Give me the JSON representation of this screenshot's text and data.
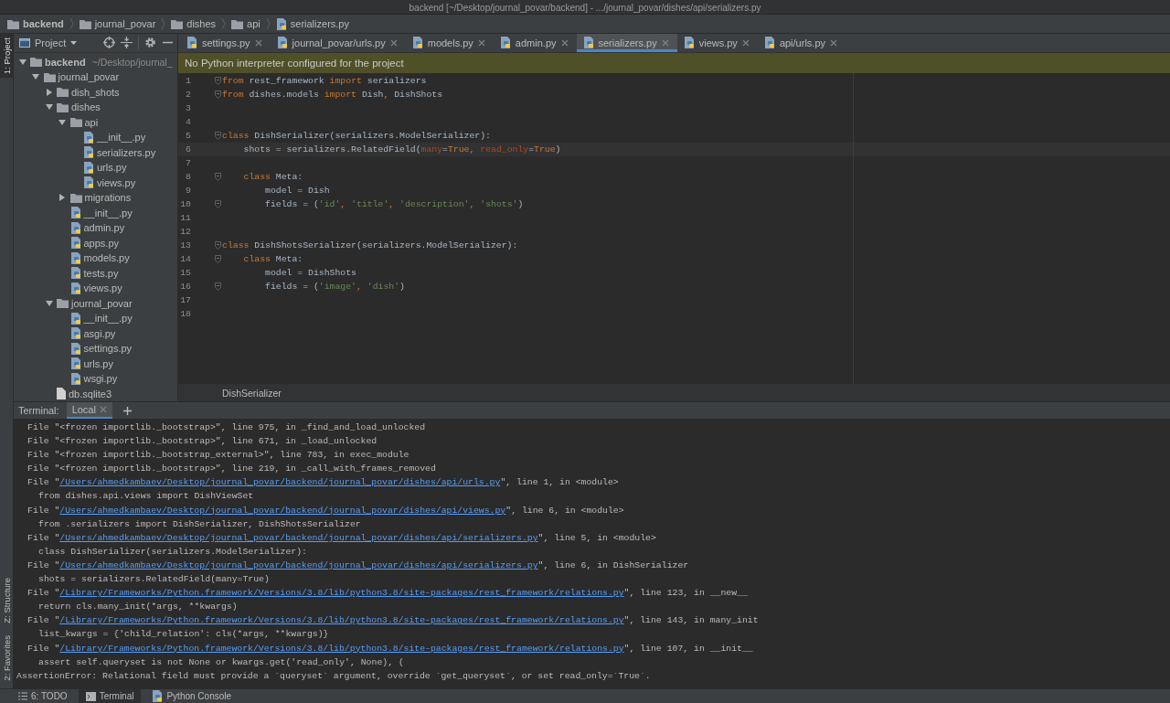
{
  "window": {
    "title": "backend [~/Desktop/journal_povar/backend] - .../journal_povar/dishes/api/serializers.py"
  },
  "breadcrumbs": [
    {
      "label": "backend",
      "kind": "folder"
    },
    {
      "label": "journal_povar",
      "kind": "folder"
    },
    {
      "label": "dishes",
      "kind": "folder"
    },
    {
      "label": "api",
      "kind": "folder"
    },
    {
      "label": "serializers.py",
      "kind": "python"
    }
  ],
  "tool_windows_top": [
    {
      "label": "1: Project",
      "selected": true
    }
  ],
  "tool_windows_bottom": [
    {
      "label": "Z: Structure",
      "selected": false
    },
    {
      "label": "2: Favorites",
      "selected": false
    }
  ],
  "project_panel": {
    "title": "Project",
    "tree": [
      {
        "label": "backend",
        "kind": "folder",
        "expanded": true,
        "hint": "~/Desktop/journal_",
        "children": [
          {
            "label": "journal_povar",
            "kind": "folder",
            "expanded": true,
            "children": [
              {
                "label": "dish_shots",
                "kind": "folder",
                "expanded": false
              },
              {
                "label": "dishes",
                "kind": "folder",
                "expanded": true,
                "children": [
                  {
                    "label": "api",
                    "kind": "folder",
                    "expanded": true,
                    "children": [
                      {
                        "label": "__init__.py",
                        "kind": "python"
                      },
                      {
                        "label": "serializers.py",
                        "kind": "python"
                      },
                      {
                        "label": "urls.py",
                        "kind": "python"
                      },
                      {
                        "label": "views.py",
                        "kind": "python"
                      }
                    ]
                  },
                  {
                    "label": "migrations",
                    "kind": "folder",
                    "expanded": false
                  },
                  {
                    "label": "__init__.py",
                    "kind": "python"
                  },
                  {
                    "label": "admin.py",
                    "kind": "python"
                  },
                  {
                    "label": "apps.py",
                    "kind": "python"
                  },
                  {
                    "label": "models.py",
                    "kind": "python"
                  },
                  {
                    "label": "tests.py",
                    "kind": "python"
                  },
                  {
                    "label": "views.py",
                    "kind": "python"
                  }
                ]
              },
              {
                "label": "journal_povar",
                "kind": "folder",
                "expanded": true,
                "children": [
                  {
                    "label": "__init__.py",
                    "kind": "python"
                  },
                  {
                    "label": "asgi.py",
                    "kind": "python"
                  },
                  {
                    "label": "settings.py",
                    "kind": "python"
                  },
                  {
                    "label": "urls.py",
                    "kind": "python"
                  },
                  {
                    "label": "wsgi.py",
                    "kind": "python"
                  }
                ]
              },
              {
                "label": "db.sqlite3",
                "kind": "file"
              }
            ]
          }
        ]
      }
    ]
  },
  "editor": {
    "tabs": [
      {
        "label": "settings.py",
        "selected": false
      },
      {
        "label": "journal_povar/urls.py",
        "selected": false
      },
      {
        "label": "models.py",
        "selected": false
      },
      {
        "label": "admin.py",
        "selected": false
      },
      {
        "label": "serializers.py",
        "selected": true
      },
      {
        "label": "views.py",
        "selected": false
      },
      {
        "label": "api/urls.py",
        "selected": false
      }
    ],
    "banner": "No Python interpreter configured for the project",
    "lines": [
      {
        "number": "1",
        "fold": true,
        "current": false,
        "tokens": [
          {
            "kind": "keyword",
            "text": "from"
          },
          {
            "kind": "plain",
            "text": " rest_framework "
          },
          {
            "kind": "keyword",
            "text": "import"
          },
          {
            "kind": "plain",
            "text": " serializers"
          }
        ]
      },
      {
        "number": "2",
        "fold": true,
        "current": false,
        "tokens": [
          {
            "kind": "keyword",
            "text": "from"
          },
          {
            "kind": "plain",
            "text": " dishes.models "
          },
          {
            "kind": "keyword",
            "text": "import"
          },
          {
            "kind": "plain",
            "text": " Dish"
          },
          {
            "kind": "keyword",
            "text": ","
          },
          {
            "kind": "plain",
            "text": " DishShots"
          }
        ]
      },
      {
        "number": "3",
        "fold": false,
        "current": false
      },
      {
        "number": "4",
        "fold": false,
        "current": false
      },
      {
        "number": "5",
        "fold": true,
        "current": false,
        "tokens": [
          {
            "kind": "keyword",
            "text": "class"
          },
          {
            "kind": "plain",
            "text": " DishSerializer(serializers.ModelSerializer):"
          }
        ]
      },
      {
        "number": "6",
        "fold": false,
        "current": true,
        "tokens": [
          {
            "kind": "plain",
            "text": "    shots = serializers.RelatedField("
          },
          {
            "kind": "param",
            "text": "many"
          },
          {
            "kind": "plain",
            "text": "="
          },
          {
            "kind": "keyword",
            "text": "True"
          },
          {
            "kind": "keyword",
            "text": ", "
          },
          {
            "kind": "param",
            "text": "read_only"
          },
          {
            "kind": "plain",
            "text": "="
          },
          {
            "kind": "keyword",
            "text": "True"
          },
          {
            "kind": "plain",
            "text": ")"
          }
        ]
      },
      {
        "number": "7",
        "fold": false,
        "current": false
      },
      {
        "number": "8",
        "fold": true,
        "current": false,
        "tokens": [
          {
            "kind": "keyword",
            "text": "    class"
          },
          {
            "kind": "plain",
            "text": " Meta:"
          }
        ]
      },
      {
        "number": "9",
        "fold": false,
        "current": false,
        "tokens": [
          {
            "kind": "plain",
            "text": "        model = Dish"
          }
        ]
      },
      {
        "number": "10",
        "fold": true,
        "current": false,
        "tokens": [
          {
            "kind": "plain",
            "text": "        fields = ("
          },
          {
            "kind": "string",
            "text": "'id'"
          },
          {
            "kind": "keyword",
            "text": ", "
          },
          {
            "kind": "string",
            "text": "'title'"
          },
          {
            "kind": "keyword",
            "text": ", "
          },
          {
            "kind": "string",
            "text": "'description'"
          },
          {
            "kind": "keyword",
            "text": ", "
          },
          {
            "kind": "string",
            "text": "'shots'"
          },
          {
            "kind": "plain",
            "text": ")"
          }
        ]
      },
      {
        "number": "11",
        "fold": false,
        "current": false
      },
      {
        "number": "12",
        "fold": false,
        "current": false
      },
      {
        "number": "13",
        "fold": true,
        "current": false,
        "tokens": [
          {
            "kind": "keyword",
            "text": "class"
          },
          {
            "kind": "plain",
            "text": " DishShotsSerializer(serializers.ModelSerializer):"
          }
        ]
      },
      {
        "number": "14",
        "fold": true,
        "current": false,
        "tokens": [
          {
            "kind": "keyword",
            "text": "    class"
          },
          {
            "kind": "plain",
            "text": " Meta:"
          }
        ]
      },
      {
        "number": "15",
        "fold": false,
        "current": false,
        "tokens": [
          {
            "kind": "plain",
            "text": "        model = DishShots"
          }
        ]
      },
      {
        "number": "16",
        "fold": true,
        "current": false,
        "tokens": [
          {
            "kind": "plain",
            "text": "        fields = ("
          },
          {
            "kind": "string",
            "text": "'image'"
          },
          {
            "kind": "keyword",
            "text": ", "
          },
          {
            "kind": "string",
            "text": "'dish'"
          },
          {
            "kind": "plain",
            "text": ")"
          }
        ]
      },
      {
        "number": "17",
        "fold": false,
        "current": false
      },
      {
        "number": "18",
        "fold": false,
        "current": false
      }
    ],
    "breadcrumb": "DishSerializer"
  },
  "terminal": {
    "label": "Terminal:",
    "tabs": [
      {
        "label": "Local",
        "selected": true
      }
    ],
    "lines": [
      {
        "kind": "frame",
        "parts": [
          {
            "kind": "text",
            "text": "File \"<frozen importlib._bootstrap>\", line 975, in _find_and_load_unlocked"
          }
        ]
      },
      {
        "kind": "frame",
        "parts": [
          {
            "kind": "text",
            "text": "File \"<frozen importlib._bootstrap>\", line 671, in _load_unlocked"
          }
        ]
      },
      {
        "kind": "frame",
        "parts": [
          {
            "kind": "text",
            "text": "File \"<frozen importlib._bootstrap_external>\", line 783, in exec_module"
          }
        ]
      },
      {
        "kind": "frame",
        "parts": [
          {
            "kind": "text",
            "text": "File \"<frozen importlib._bootstrap>\", line 219, in _call_with_frames_removed"
          }
        ]
      },
      {
        "kind": "frame",
        "parts": [
          {
            "kind": "text",
            "text": "File \""
          },
          {
            "kind": "link",
            "text": "/Users/ahmedkambaev/Desktop/journal_povar/backend/journal_povar/dishes/api/urls.py"
          },
          {
            "kind": "text",
            "text": "\", line 1, in <module>"
          }
        ]
      },
      {
        "kind": "source",
        "parts": [
          {
            "kind": "text",
            "text": "from dishes.api.views import DishViewSet"
          }
        ]
      },
      {
        "kind": "frame",
        "parts": [
          {
            "kind": "text",
            "text": "File \""
          },
          {
            "kind": "link",
            "text": "/Users/ahmedkambaev/Desktop/journal_povar/backend/journal_povar/dishes/api/views.py"
          },
          {
            "kind": "text",
            "text": "\", line 6, in <module>"
          }
        ]
      },
      {
        "kind": "source",
        "parts": [
          {
            "kind": "text",
            "text": "from .serializers import DishSerializer, DishShotsSerializer"
          }
        ]
      },
      {
        "kind": "frame",
        "parts": [
          {
            "kind": "text",
            "text": "File \""
          },
          {
            "kind": "link",
            "text": "/Users/ahmedkambaev/Desktop/journal_povar/backend/journal_povar/dishes/api/serializers.py"
          },
          {
            "kind": "text",
            "text": "\", line 5, in <module>"
          }
        ]
      },
      {
        "kind": "source",
        "parts": [
          {
            "kind": "text",
            "text": "class DishSerializer(serializers.ModelSerializer):"
          }
        ]
      },
      {
        "kind": "frame",
        "parts": [
          {
            "kind": "text",
            "text": "File \""
          },
          {
            "kind": "link",
            "text": "/Users/ahmedkambaev/Desktop/journal_povar/backend/journal_povar/dishes/api/serializers.py"
          },
          {
            "kind": "text",
            "text": "\", line 6, in DishSerializer"
          }
        ]
      },
      {
        "kind": "source",
        "parts": [
          {
            "kind": "text",
            "text": "shots = serializers.RelatedField(many=True)"
          }
        ]
      },
      {
        "kind": "frame",
        "parts": [
          {
            "kind": "text",
            "text": "File \""
          },
          {
            "kind": "link",
            "text": "/Library/Frameworks/Python.framework/Versions/3.8/lib/python3.8/site-packages/rest_framework/relations.py"
          },
          {
            "kind": "text",
            "text": "\", line 123, in __new__"
          }
        ]
      },
      {
        "kind": "source",
        "parts": [
          {
            "kind": "text",
            "text": "return cls.many_init(*args, **kwargs)"
          }
        ]
      },
      {
        "kind": "frame",
        "parts": [
          {
            "kind": "text",
            "text": "File \""
          },
          {
            "kind": "link",
            "text": "/Library/Frameworks/Python.framework/Versions/3.8/lib/python3.8/site-packages/rest_framework/relations.py"
          },
          {
            "kind": "text",
            "text": "\", line 143, in many_init"
          }
        ]
      },
      {
        "kind": "source",
        "parts": [
          {
            "kind": "text",
            "text": "list_kwargs = {'child_relation': cls(*args, **kwargs)}"
          }
        ]
      },
      {
        "kind": "frame",
        "parts": [
          {
            "kind": "text",
            "text": "File \""
          },
          {
            "kind": "link",
            "text": "/Library/Frameworks/Python.framework/Versions/3.8/lib/python3.8/site-packages/rest_framework/relations.py"
          },
          {
            "kind": "text",
            "text": "\", line 107, in __init__"
          }
        ]
      },
      {
        "kind": "source",
        "parts": [
          {
            "kind": "text",
            "text": "assert self.queryset is not None or kwargs.get('read_only', None), ("
          }
        ]
      },
      {
        "kind": "error",
        "parts": [
          {
            "kind": "text",
            "text": "AssertionError: Relational field must provide a `queryset` argument, override `get_queryset`, or set read_only=`True`."
          }
        ]
      }
    ]
  },
  "bottom_tabs": [
    {
      "label": "6: TODO",
      "kind": "todo",
      "selected": false
    },
    {
      "label": "Terminal",
      "kind": "terminal",
      "selected": true
    },
    {
      "label": "Python Console",
      "kind": "python",
      "selected": false
    }
  ]
}
